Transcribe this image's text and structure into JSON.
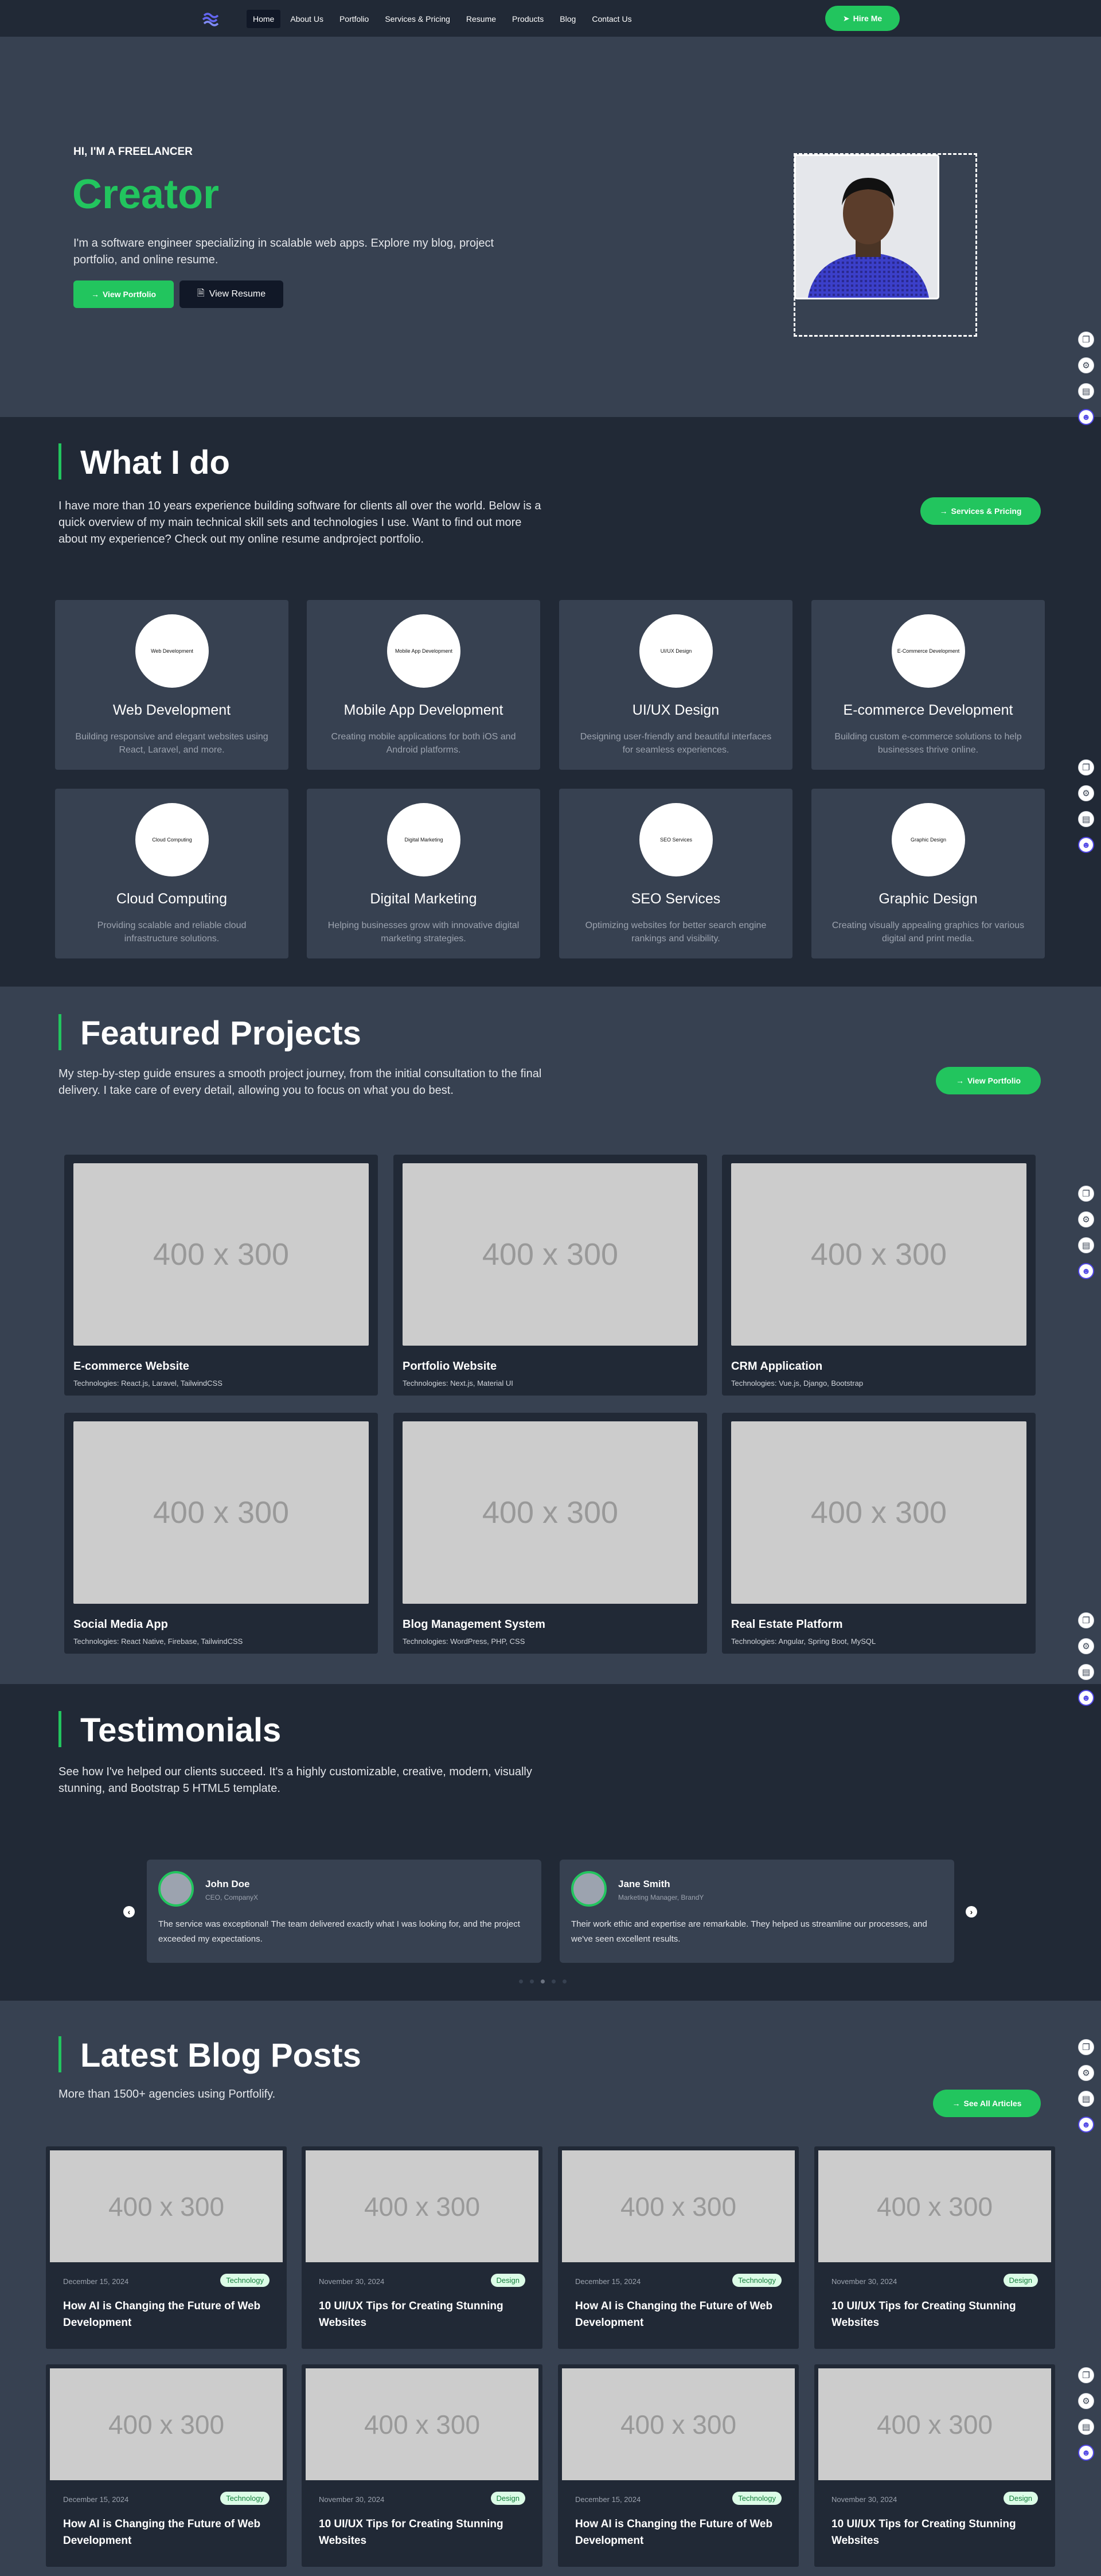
{
  "nav": {
    "links": [
      "Home",
      "About Us",
      "Portfolio",
      "Services & Pricing",
      "Resume",
      "Products",
      "Blog",
      "Contact Us"
    ],
    "active": "Home",
    "hire": "Hire Me"
  },
  "hero": {
    "eyebrow": "HI, I'M A FREELANCER",
    "title": "Creator",
    "desc": "I'm a software engineer specializing in scalable web apps. Explore my blog, project portfolio, and online resume.",
    "btn_portfolio": "View Portfolio",
    "btn_resume": "View Resume"
  },
  "whatido": {
    "title": "What I do",
    "desc": "I have more than 10 years experience building software for clients all over the world. Below is a quick overview of my main technical skill sets and technologies I use. Want to find out more about my experience? Check out my online resume andproject portfolio.",
    "button": "Services & Pricing",
    "services": [
      {
        "icon": "Web Development",
        "title": "Web Development",
        "desc": "Building responsive and elegant websites using React, Laravel, and more."
      },
      {
        "icon": "Mobile App Development",
        "title": "Mobile App Development",
        "desc": "Creating mobile applications for both iOS and Android platforms."
      },
      {
        "icon": "UI/UX Design",
        "title": "UI/UX Design",
        "desc": "Designing user-friendly and beautiful interfaces for seamless experiences."
      },
      {
        "icon": "E-Commerce Development",
        "title": "E-commerce Development",
        "desc": "Building custom e-commerce solutions to help businesses thrive online."
      },
      {
        "icon": "Cloud Computing",
        "title": "Cloud Computing",
        "desc": "Providing scalable and reliable cloud infrastructure solutions."
      },
      {
        "icon": "Digital Marketing",
        "title": "Digital Marketing",
        "desc": "Helping businesses grow with innovative digital marketing strategies."
      },
      {
        "icon": "SEO Services",
        "title": "SEO Services",
        "desc": "Optimizing websites for better search engine rankings and visibility."
      },
      {
        "icon": "Graphic Design",
        "title": "Graphic Design",
        "desc": "Creating visually appealing graphics for various digital and print media."
      }
    ]
  },
  "projects": {
    "title": "Featured Projects",
    "desc": "My step-by-step guide ensures a smooth project journey, from the initial consultation to the final delivery. I take care of every detail, allowing you to focus on what you do best.",
    "button": "View Portfolio",
    "placeholder": "400 x 300",
    "items": [
      {
        "title": "E-commerce Website",
        "tech": "Technologies: React.js, Laravel, TailwindCSS"
      },
      {
        "title": "Portfolio Website",
        "tech": "Technologies: Next.js, Material UI"
      },
      {
        "title": "CRM Application",
        "tech": "Technologies: Vue.js, Django, Bootstrap"
      },
      {
        "title": "Social Media App",
        "tech": "Technologies: React Native, Firebase, TailwindCSS"
      },
      {
        "title": "Blog Management System",
        "tech": "Technologies: WordPress, PHP, CSS"
      },
      {
        "title": "Real Estate Platform",
        "tech": "Technologies: Angular, Spring Boot, MySQL"
      }
    ]
  },
  "testimonials": {
    "title": "Testimonials",
    "desc": "See how I've helped our clients succeed. It's a highly customizable, creative, modern, visually stunning, and Bootstrap 5 HTML5 template.",
    "items": [
      {
        "name": "John Doe",
        "role": "CEO, CompanyX",
        "text": "The service was exceptional! The team delivered exactly what I was looking for, and the project exceeded my expectations."
      },
      {
        "name": "Jane Smith",
        "role": "Marketing Manager, BrandY",
        "text": "Their work ethic and expertise are remarkable. They helped us streamline our processes, and we've seen excellent results."
      }
    ]
  },
  "blog": {
    "title": "Latest Blog Posts",
    "desc": "More than 1500+ agencies using Portfolify.",
    "button": "See All Articles",
    "placeholder": "400 x 300",
    "posts": [
      {
        "date": "December 15, 2024",
        "tag": "Technology",
        "title": "How AI is Changing the Future of Web Development"
      },
      {
        "date": "November 30, 2024",
        "tag": "Design",
        "title": "10 UI/UX Tips for Creating Stunning Websites"
      },
      {
        "date": "December 15, 2024",
        "tag": "Technology",
        "title": "How AI is Changing the Future of Web Development"
      },
      {
        "date": "November 30, 2024",
        "tag": "Design",
        "title": "10 UI/UX Tips for Creating Stunning Websites"
      },
      {
        "date": "December 15, 2024",
        "tag": "Technology",
        "title": "How AI is Changing the Future of Web Development"
      },
      {
        "date": "November 30, 2024",
        "tag": "Design",
        "title": "10 UI/UX Tips for Creating Stunning Websites"
      },
      {
        "date": "December 15, 2024",
        "tag": "Technology",
        "title": "How AI is Changing the Future of Web Development"
      },
      {
        "date": "November 30, 2024",
        "tag": "Design",
        "title": "10 UI/UX Tips for Creating Stunning Websites"
      }
    ]
  },
  "side_widget": {
    "icons": [
      "copy-icon",
      "settings-icon",
      "layers-icon",
      "assistant-icon"
    ]
  },
  "colors": {
    "accent": "#22c55e",
    "dark": "#212936",
    "panel": "#374151"
  }
}
